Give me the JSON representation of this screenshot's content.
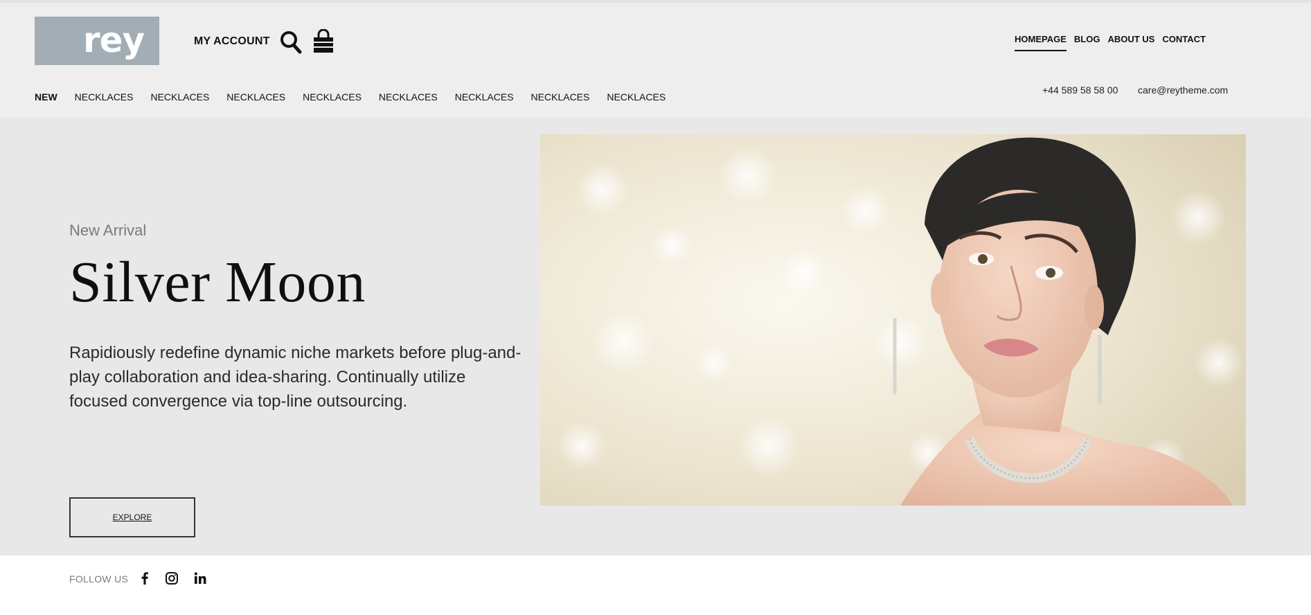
{
  "header": {
    "logo_text": "rey",
    "account_label": "MY ACCOUNT",
    "icons": [
      "search-icon",
      "shopping-bag-icon"
    ],
    "main_nav": [
      {
        "label": "HOMEPAGE",
        "active": true
      },
      {
        "label": "BLOG",
        "active": false
      },
      {
        "label": "ABOUT US",
        "active": false
      },
      {
        "label": "CONTACT",
        "active": false
      }
    ],
    "categories": [
      "NEW",
      "NECKLACES",
      "NECKLACES",
      "NECKLACES",
      "NECKLACES",
      "NECKLACES",
      "NECKLACES",
      "NECKLACES",
      "NECKLACES"
    ],
    "phone": "+44 589 58 58 00",
    "email": "care@reytheme.com"
  },
  "hero": {
    "eyebrow": "New Arrival",
    "title": "Silver Moon",
    "description": "Rapidiously redefine dynamic niche markets before plug-and-play collaboration and idea-sharing. Continually utilize focused convergence via top-line outsourcing.",
    "button_label": "EXPLORE",
    "image": "woman-with-diamond-earrings-and-necklace-photo"
  },
  "footer": {
    "follow_label": "FOLLOW US",
    "social_icons": [
      "facebook-icon",
      "instagram-icon",
      "linkedin-icon"
    ]
  },
  "colors": {
    "header_bg": "#eeeeee",
    "hero_bg": "#e8e8e8",
    "logo_bg": "#a2adb5",
    "text": "#111111"
  }
}
